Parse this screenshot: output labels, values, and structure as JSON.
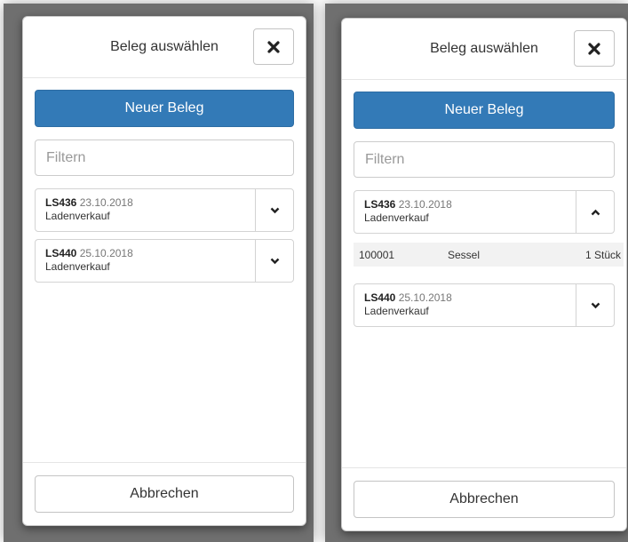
{
  "dialogs": [
    {
      "title": "Beleg auswählen",
      "new_button": "Neuer Beleg",
      "filter_placeholder": "Filtern",
      "items": [
        {
          "number": "LS436",
          "date": "23.10.2018",
          "type": "Ladenverkauf",
          "expanded": false,
          "toggle_icon": "chevron-down-icon"
        },
        {
          "number": "LS440",
          "date": "25.10.2018",
          "type": "Ladenverkauf",
          "expanded": false,
          "toggle_icon": "chevron-down-icon"
        }
      ],
      "cancel_button": "Abbrechen"
    },
    {
      "title": "Beleg auswählen",
      "new_button": "Neuer Beleg",
      "filter_placeholder": "Filtern",
      "items": [
        {
          "number": "LS436",
          "date": "23.10.2018",
          "type": "Ladenverkauf",
          "expanded": true,
          "toggle_icon": "chevron-up-icon",
          "positions": [
            {
              "article_no": "100001",
              "name": "Sessel",
              "quantity": "1 Stück"
            }
          ]
        },
        {
          "number": "LS440",
          "date": "25.10.2018",
          "type": "Ladenverkauf",
          "expanded": false,
          "toggle_icon": "chevron-down-icon"
        }
      ],
      "cancel_button": "Abbrechen"
    }
  ],
  "colors": {
    "primary": "#337ab7",
    "backdrop": "#6f6f6f",
    "detail_row_bg": "#f2f2f2"
  }
}
